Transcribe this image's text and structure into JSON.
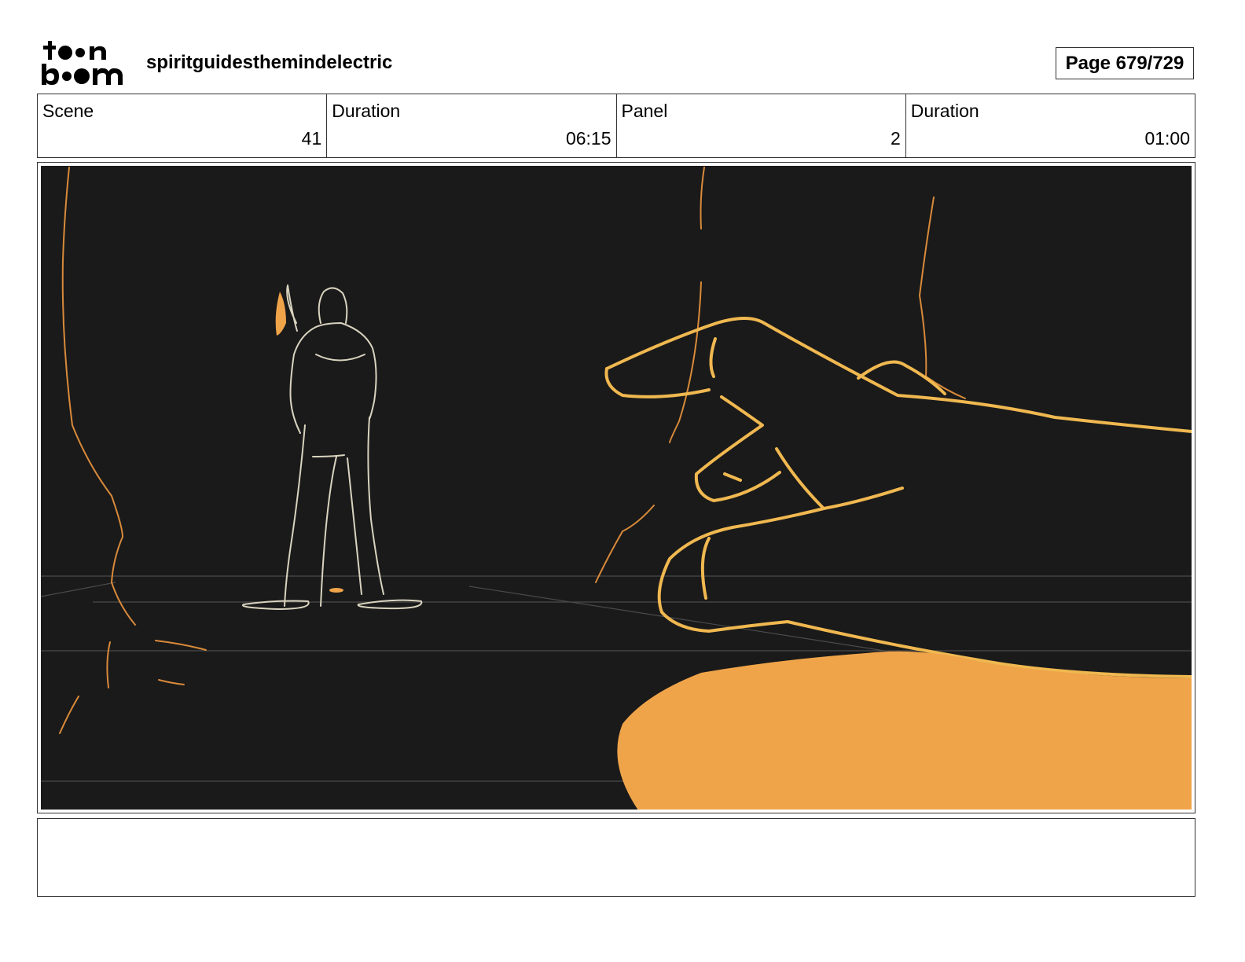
{
  "header": {
    "logo_icon": "toonboom-logo",
    "logo_text": "toon boom",
    "project_title": "spiritguidesthemindelectric",
    "page_label": "Page 679/729"
  },
  "info": {
    "scene_label": "Scene",
    "scene_value": "41",
    "scene_duration_label": "Duration",
    "scene_duration_value": "06:15",
    "panel_label": "Panel",
    "panel_value": "2",
    "panel_duration_label": "Duration",
    "panel_duration_value": "01:00"
  },
  "colors": {
    "panel_bg": "#1a1a1a",
    "accent_orange": "#f0a44a",
    "sketch_line": "#d9d3bf"
  },
  "notes": {
    "text": ""
  }
}
